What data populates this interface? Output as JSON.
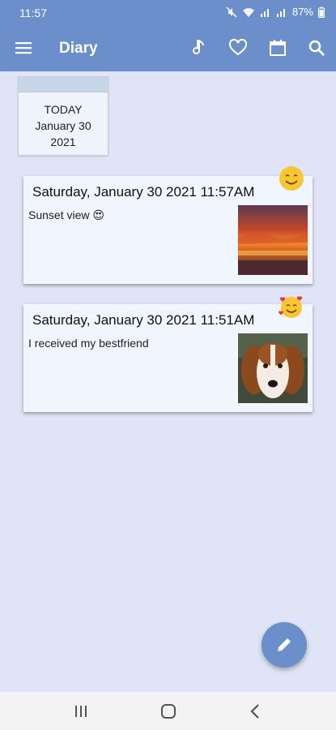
{
  "status_bar": {
    "time": "11:57",
    "battery": "87%"
  },
  "app_bar": {
    "title": "Diary",
    "icons": [
      "menu-icon",
      "music-note-icon",
      "heart-icon",
      "calendar-icon",
      "search-icon"
    ]
  },
  "today_card": {
    "label": "TODAY",
    "date": "January 30",
    "year": "2021"
  },
  "entries": [
    {
      "datetime": "Saturday, January 30 2021 11:57AM",
      "text": "Sunset view 😍",
      "mood": "smiling-face-icon",
      "photo": "sunset-photo"
    },
    {
      "datetime": "Saturday, January 30 2021 11:51AM",
      "text": "I received my bestfriend",
      "mood": "smiling-face-with-hearts-icon",
      "photo": "dog-photo"
    }
  ],
  "fab": {
    "icon": "pencil-icon"
  },
  "nav_bar": {
    "icons": [
      "recent-apps-icon",
      "home-icon",
      "back-icon"
    ]
  },
  "colors": {
    "primary": "#6b8fcb",
    "background": "#dfe5f6",
    "card": "#f1f6fe"
  }
}
